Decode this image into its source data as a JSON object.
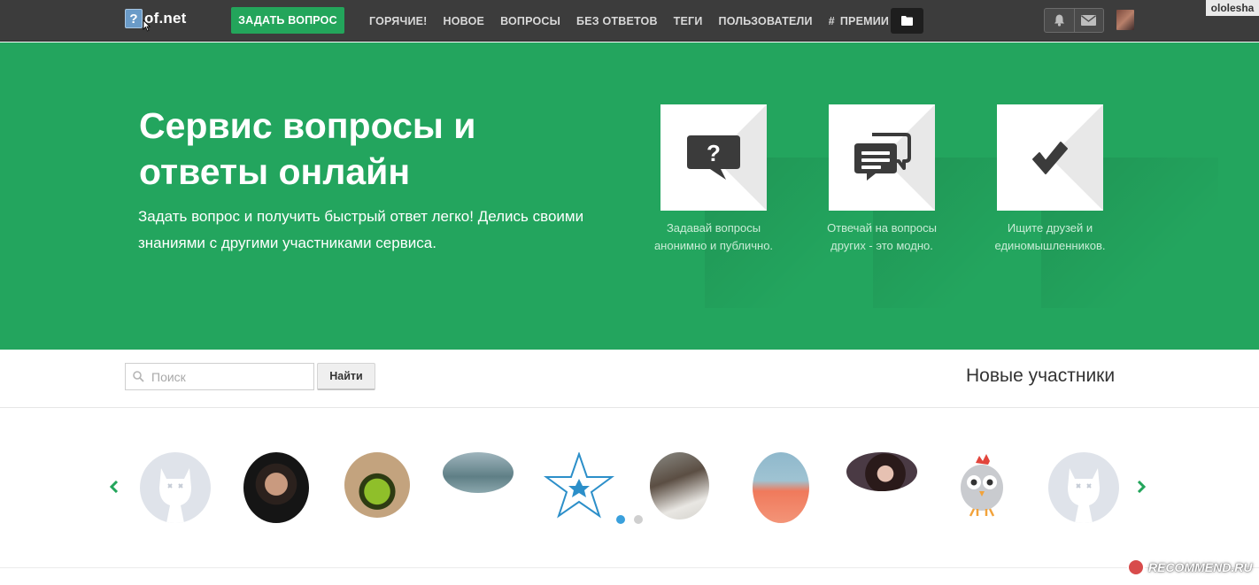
{
  "topbar": {
    "logo_mark": "?",
    "logo_text": "of.net",
    "ask_button": "ЗАДАТЬ ВОПРОС",
    "nav": [
      "ГОРЯЧИЕ!",
      "НОВОЕ",
      "ВОПРОСЫ",
      "БЕЗ ОТВЕТОВ",
      "ТЕГИ",
      "ПОЛЬЗОВАТЕЛИ",
      "ПРЕМИИ"
    ],
    "username": "ololesha",
    "icons": [
      "folder-icon",
      "bell-icon",
      "envelope-icon",
      "user-avatar"
    ]
  },
  "hero": {
    "title": "Сервис вопросы и ответы онлайн",
    "subtitle": "Задать вопрос и получить быстрый ответ легко! Делись своими знаниями с другими участниками сервиса.",
    "features": [
      {
        "icon": "question-bubble-icon",
        "text": "Задавай вопросы анонимно и публично."
      },
      {
        "icon": "chat-bubbles-icon",
        "text": "Отвечай на вопросы других - это модно."
      },
      {
        "icon": "checkmark-icon",
        "text": "Ищите друзей и единомышленников."
      }
    ],
    "background_color": "#23a55e"
  },
  "search": {
    "placeholder": "Поиск",
    "button": "Найти"
  },
  "new_members": {
    "title": "Новые участники",
    "active_page": 1,
    "pages": 2
  },
  "watermark": "RECOMMEND.RU",
  "colors": {
    "accent": "#23a55b",
    "topbar": "#3c3c3c",
    "dot_active": "#3aa0dc"
  }
}
